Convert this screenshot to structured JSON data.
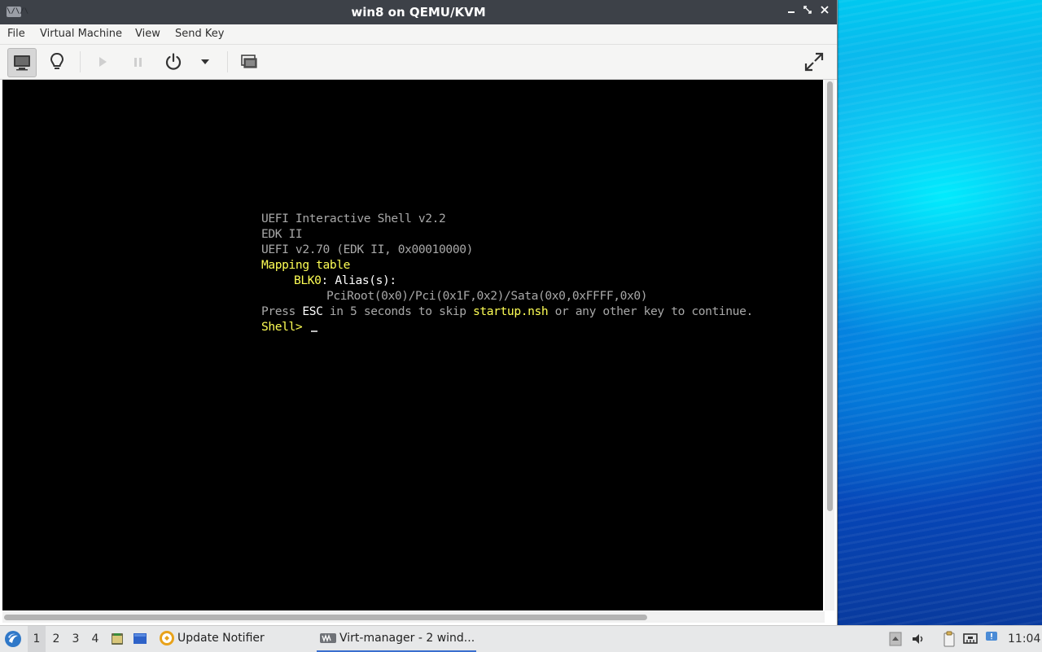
{
  "window": {
    "title": "win8 on QEMU/KVM",
    "app_icon_text": "\\/\\/\\",
    "buttons": {
      "minimize": "▁",
      "maximize": "⤢",
      "close": "✕"
    }
  },
  "menu": {
    "items": [
      "File",
      "Virtual Machine",
      "View",
      "Send Key"
    ]
  },
  "toolbar": {
    "icons": [
      "monitor-icon",
      "lightbulb-icon",
      "play-icon",
      "pause-icon",
      "power-icon",
      "chevron-down-icon",
      "snapshot-icon",
      "fullscreen-icon"
    ]
  },
  "console": {
    "line1": "UEFI Interactive Shell v2.2",
    "line2": "EDK II",
    "line3": "UEFI v2.70 (EDK II, 0x00010000)",
    "line4": "Mapping table",
    "line5_name": "BLK0",
    "line5_rest": ": Alias(s):",
    "line6": "PciRoot(0x0)/Pci(0x1F,0x2)/Sata(0x0,0xFFFF,0x0)",
    "line7_a": "Press ",
    "line7_esc": "ESC",
    "line7_b": " in 5 seconds to skip ",
    "line7_file": "startup.nsh",
    "line7_c": " or any other key to continue.",
    "prompt": "Shell> ",
    "colors": {
      "text": "#a8a8a8",
      "highlight": "#ffff55",
      "bright": "#ffffff"
    }
  },
  "taskbar": {
    "workspaces": [
      "1",
      "2",
      "3",
      "4"
    ],
    "active_workspace": "1",
    "tasks": {
      "update_notifier": "Update Notifier",
      "virt_manager": "Virt-manager - 2 wind..."
    },
    "clock": "11:04"
  }
}
